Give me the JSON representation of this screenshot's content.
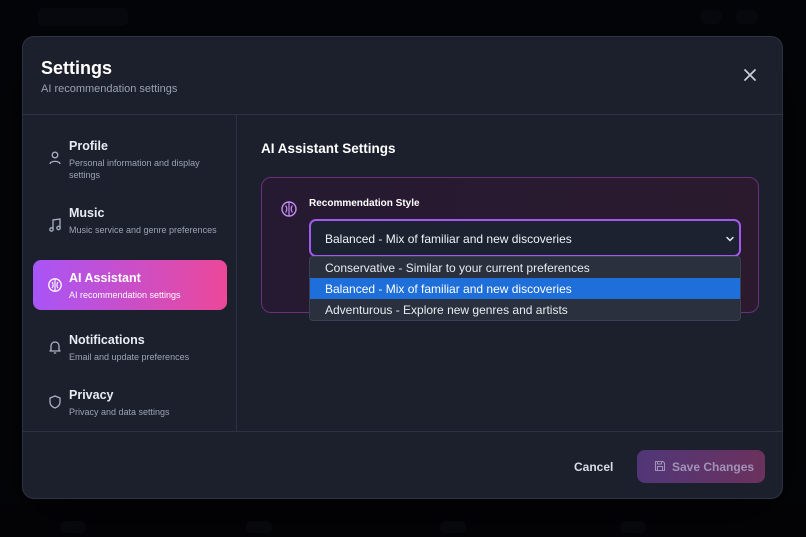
{
  "modal": {
    "title": "Settings",
    "subtitle": "AI recommendation settings"
  },
  "sidebar": {
    "items": [
      {
        "label": "Profile",
        "desc": "Personal information and display settings",
        "icon": "user-icon"
      },
      {
        "label": "Music",
        "desc": "Music service and genre preferences",
        "icon": "music-note-icon"
      },
      {
        "label": "AI Assistant",
        "desc": "AI recommendation settings",
        "icon": "brain-icon",
        "active": true
      },
      {
        "label": "Notifications",
        "desc": "Email and update preferences",
        "icon": "bell-icon"
      },
      {
        "label": "Privacy",
        "desc": "Privacy and data settings",
        "icon": "shield-icon"
      }
    ]
  },
  "content": {
    "title": "AI Assistant Settings",
    "recommendation": {
      "label": "Recommendation Style",
      "selected": "Balanced - Mix of familiar and new discoveries",
      "options": [
        "Conservative - Similar to your current preferences",
        "Balanced - Mix of familiar and new discoveries",
        "Adventurous - Explore new genres and artists"
      ]
    }
  },
  "footer": {
    "cancel_label": "Cancel",
    "save_label": "Save Changes"
  },
  "colors": {
    "accent_start": "#a855f7",
    "accent_end": "#ec4899",
    "dropdown_highlight": "#1e6fd9"
  }
}
